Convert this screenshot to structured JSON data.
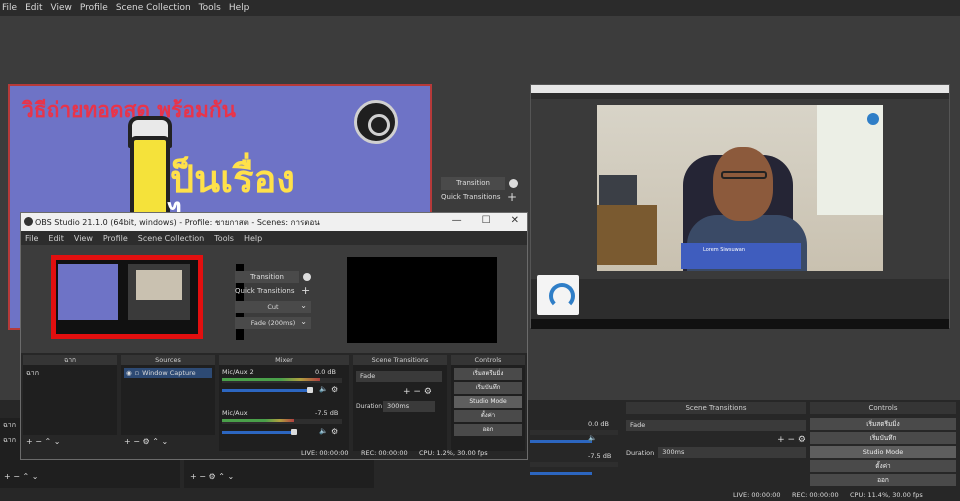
{
  "menu": [
    "File",
    "Edit",
    "View",
    "Profile",
    "Scene Collection",
    "Tools",
    "Help"
  ],
  "card": {
    "title": "วิธีถ่ายทอดสด พร้อมกัน",
    "big_line1": "ป็นเรื่อง",
    "big_line2": "ไ"
  },
  "transition_panel": {
    "transition_label": "Transition",
    "quick_label": "Quick Transitions"
  },
  "embed": {
    "lower_third": "Lorem Siwsuwan"
  },
  "window": {
    "title": "OBS Studio 21.1.0 (64bit, windows) - Profile: ชายกาสต - Scenes: การตอน",
    "controls": [
      "—",
      "☐",
      "✕"
    ],
    "menu": [
      "File",
      "Edit",
      "View",
      "Profile",
      "Scene Collection",
      "Tools",
      "Help"
    ],
    "transition_label": "Transition",
    "quick_label": "Quick Transitions",
    "cut_label": "Cut",
    "fade_label": "Fade (200ms)",
    "docks": {
      "scenes_header": "ฉาก",
      "scenes_items": [
        "ฉาก"
      ],
      "sources_header": "Sources",
      "sources_items": [
        "Window Capture"
      ],
      "mixer_header": "Mixer",
      "mixer_channels": [
        {
          "name": "Mic/Aux 2",
          "db": "0.0 dB",
          "level": 0.82
        },
        {
          "name": "Mic/Aux",
          "db": "-7.5 dB",
          "level": 0.6
        }
      ],
      "transitions_header": "Scene Transitions",
      "transition_select": "Fade",
      "duration_label": "Duration",
      "duration_value": "300ms",
      "controls_header": "Controls",
      "controls_buttons": [
        "เริ่มสตรีมมิ่ง",
        "เริ่มบันทึก",
        "Studio Mode",
        "ตั้งค่า",
        "ออก"
      ]
    },
    "status": {
      "live": "LIVE: 00:00:00",
      "rec": "REC: 00:00:00",
      "cpu": "CPU: 1.2%, 30.00 fps"
    }
  },
  "bottom": {
    "scenes_item_1": "ฉาก",
    "scenes_item_2": "ฉาก",
    "mixer_db_1": "0.0 dB",
    "mixer_db_2": "-7.5 dB",
    "transitions_header": "Scene Transitions",
    "transition_select": "Fade",
    "duration_label": "Duration",
    "duration_value": "300ms",
    "controls_header": "Controls",
    "controls_buttons": [
      "เริ่มสตรีมมิ่ง",
      "เริ่มบันทึก",
      "Studio Mode",
      "ตั้งค่า",
      "ออก"
    ],
    "status": {
      "live": "LIVE: 00:00:00",
      "rec": "REC: 00:00:00",
      "cpu": "CPU: 11.4%, 30.00 fps"
    }
  },
  "colors": {
    "highlight_red": "#e20f0f",
    "card_purple": "#6e73c6",
    "accent_yellow": "#ffe14a",
    "muted_red": "#e24a4a"
  }
}
